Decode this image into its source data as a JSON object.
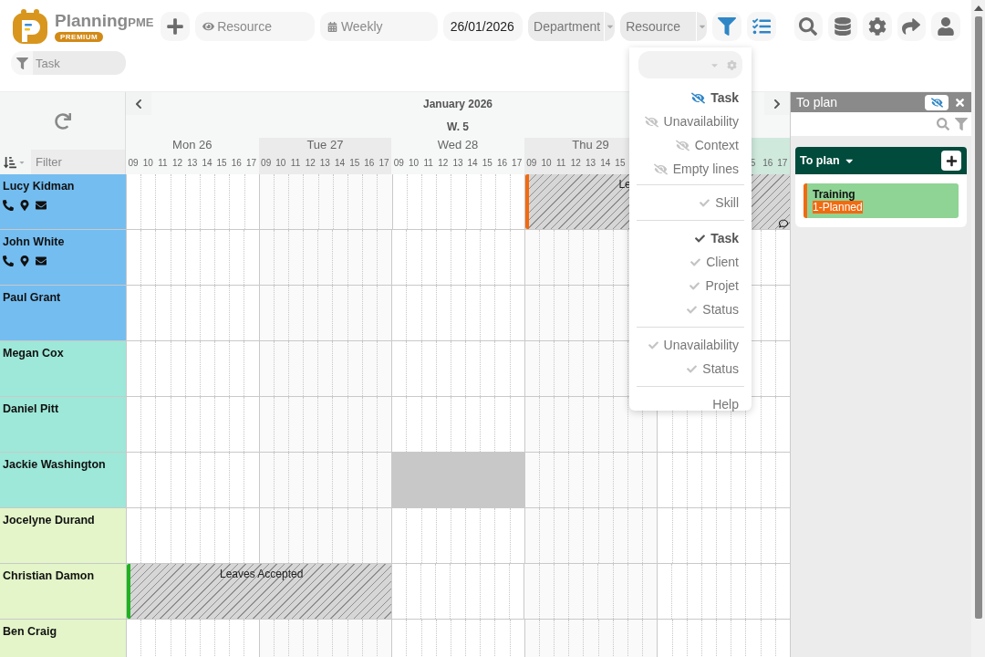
{
  "brand": {
    "name": "Planning",
    "suffix": "PME",
    "badge": "PREMIUM"
  },
  "toolbar": {
    "view_field": {
      "placeholder": "Resource"
    },
    "period_field": {
      "value": "Weekly"
    },
    "date_field": {
      "value": "26/01/2026"
    },
    "department_select": {
      "value": "Department"
    },
    "resource_select": {
      "value": "Resource"
    },
    "task_filter": {
      "placeholder": "Task"
    }
  },
  "grid": {
    "month": "January 2026",
    "week": "W. 5",
    "filter_placeholder": "Filter",
    "days": [
      {
        "label": "Mon 26",
        "today": false,
        "partial": false,
        "hours": [
          "09",
          "10",
          "11",
          "12",
          "13",
          "14",
          "15",
          "16",
          "17"
        ]
      },
      {
        "label": "Tue 27",
        "today": false,
        "partial": false,
        "hours": [
          "09",
          "10",
          "11",
          "12",
          "13",
          "14",
          "15",
          "16",
          "17"
        ]
      },
      {
        "label": "Wed 28",
        "today": false,
        "partial": false,
        "hours": [
          "09",
          "10",
          "11",
          "12",
          "13",
          "14",
          "15",
          "16",
          "17"
        ]
      },
      {
        "label": "Thu 29",
        "today": false,
        "partial": false,
        "hours": [
          "09",
          "10",
          "11",
          "12",
          "13",
          "14",
          "15"
        ]
      },
      {
        "today": true,
        "partial": true,
        "hours": [
          "5",
          "16",
          "17"
        ]
      }
    ]
  },
  "resources": [
    {
      "name": "Lucy Kidman",
      "color": "#74bdf0",
      "contact_icons": true,
      "cells": [
        {
          "kind": "empty"
        },
        {
          "kind": "empty"
        },
        {
          "kind": "empty"
        },
        {
          "kind": "leave",
          "label": "Le",
          "color": "#f26a10",
          "comment": true
        },
        {
          "kind": "continued"
        }
      ]
    },
    {
      "name": "John White",
      "color": "#74bdf0",
      "contact_icons": true,
      "cells": [
        {
          "kind": "empty"
        },
        {
          "kind": "empty"
        },
        {
          "kind": "empty"
        },
        {
          "kind": "empty"
        },
        {
          "kind": "empty"
        }
      ]
    },
    {
      "name": "Paul Grant",
      "color": "#74bdf0",
      "contact_icons": false,
      "cells": [
        {
          "kind": "empty"
        },
        {
          "kind": "empty"
        },
        {
          "kind": "empty"
        },
        {
          "kind": "empty"
        },
        {
          "kind": "empty"
        }
      ]
    },
    {
      "name": "Megan Cox",
      "color": "#9de8d8",
      "contact_icons": false,
      "cells": [
        {
          "kind": "empty"
        },
        {
          "kind": "empty"
        },
        {
          "kind": "empty"
        },
        {
          "kind": "empty"
        },
        {
          "kind": "empty"
        }
      ]
    },
    {
      "name": "Daniel Pitt",
      "color": "#9de8d8",
      "contact_icons": false,
      "cells": [
        {
          "kind": "empty"
        },
        {
          "kind": "empty"
        },
        {
          "kind": "empty"
        },
        {
          "kind": "empty"
        },
        {
          "kind": "empty"
        }
      ]
    },
    {
      "name": "Jackie Washington",
      "color": "#9de8d8",
      "contact_icons": false,
      "cells": [
        {
          "kind": "empty"
        },
        {
          "kind": "empty"
        },
        {
          "kind": "blocked"
        },
        {
          "kind": "empty"
        },
        {
          "kind": "empty"
        }
      ]
    },
    {
      "name": "Jocelyne Durand",
      "color": "#e3f5c9",
      "contact_icons": false,
      "cells": [
        {
          "kind": "empty"
        },
        {
          "kind": "empty"
        },
        {
          "kind": "empty"
        },
        {
          "kind": "empty"
        },
        {
          "kind": "empty"
        }
      ]
    },
    {
      "name": "Christian Damon",
      "color": "#e3f5c9",
      "contact_icons": false,
      "cells": [
        {
          "kind": "leave",
          "label": "Leaves Accepted",
          "color": "#1db31d",
          "comment": false
        },
        {
          "kind": "continued"
        },
        {
          "kind": "empty"
        },
        {
          "kind": "empty"
        },
        {
          "kind": "empty"
        }
      ]
    },
    {
      "name": "Ben Craig",
      "color": "#e3f5c9",
      "contact_icons": false,
      "cells": [
        {
          "kind": "empty"
        },
        {
          "kind": "empty"
        },
        {
          "kind": "empty"
        },
        {
          "kind": "empty"
        },
        {
          "kind": "empty"
        }
      ]
    }
  ],
  "display_menu": {
    "sections": [
      [
        {
          "kind": "visibility",
          "label": "Task",
          "on": true
        },
        {
          "kind": "visibility",
          "label": "Unavailability",
          "on": false
        },
        {
          "kind": "visibility",
          "label": "Context",
          "on": false
        },
        {
          "kind": "visibility",
          "label": "Empty lines",
          "on": false
        }
      ],
      [
        {
          "kind": "check",
          "label": "Skill",
          "on": false
        }
      ],
      [
        {
          "kind": "check",
          "label": "Task",
          "on": true
        },
        {
          "kind": "check",
          "label": "Client",
          "on": false
        },
        {
          "kind": "check",
          "label": "Projet",
          "on": false
        },
        {
          "kind": "check",
          "label": "Status",
          "on": false
        }
      ],
      [
        {
          "kind": "check",
          "label": "Unavailability",
          "on": false
        },
        {
          "kind": "check",
          "label": "Status",
          "on": false
        }
      ],
      [
        {
          "kind": "link",
          "label": "Help"
        }
      ]
    ]
  },
  "to_plan_panel": {
    "title": "To plan",
    "group": {
      "title": "To plan",
      "tasks": [
        {
          "name": "Training",
          "status": "1-Planned",
          "color": "#f26a10"
        }
      ]
    }
  }
}
